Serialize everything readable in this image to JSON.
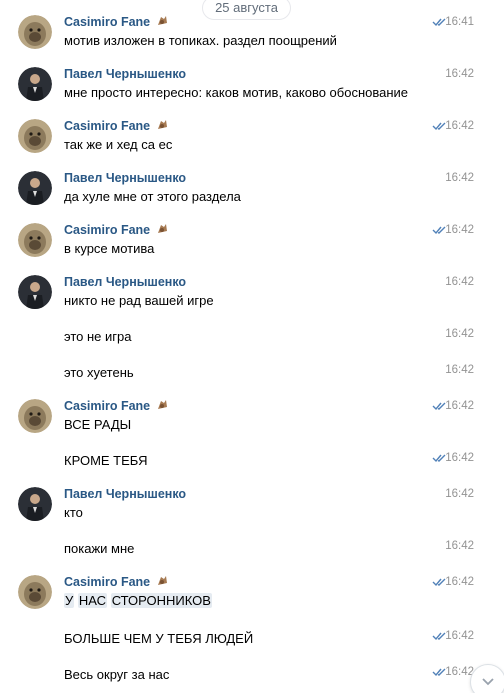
{
  "date_separator": "25 августа",
  "users": {
    "casimiro": "Casimiro Fane",
    "pavel": "Павел Чернышенко"
  },
  "messages": [
    {
      "text": "мотив изложен в топиках. раздел поощрений",
      "time": "16:41"
    },
    {
      "text": "мне просто интересно: каков мотив, каково обоснование",
      "time": "16:42"
    },
    {
      "text": "так же и хед са ес",
      "time": "16:42"
    },
    {
      "text": "да хуле мне от этого раздела",
      "time": "16:42"
    },
    {
      "text": "в курсе мотива",
      "time": "16:42"
    },
    {
      "text": "никто не рад вашей игре",
      "time": "16:42"
    },
    {
      "text": "это не игра",
      "time": "16:42"
    },
    {
      "text": "это хуетень",
      "time": "16:42"
    },
    {
      "text": "ВСЕ РАДЫ",
      "time": "16:42"
    },
    {
      "text": "КРОМЕ ТЕБЯ",
      "time": "16:42"
    },
    {
      "text": "кто",
      "time": "16:42"
    },
    {
      "text": "покажи мне",
      "time": "16:42"
    },
    {
      "text_parts": [
        "У",
        "НАС",
        "СТОРОННИКОВ"
      ],
      "time": "16:42"
    },
    {
      "text": "БОЛЬШЕ ЧЕМ У ТЕБЯ ЛЮДЕЙ",
      "time": "16:42"
    },
    {
      "text": "Весь округ за нас",
      "time": "16:42"
    }
  ],
  "icons": {
    "read_status": "double-check-icon",
    "badge": "sticker-badge-icon",
    "scroll": "chevron-down-icon"
  },
  "colors": {
    "author": "#2a5885",
    "time": "#939393",
    "check": "#5181b8",
    "highlight": "#e5ebf1"
  }
}
